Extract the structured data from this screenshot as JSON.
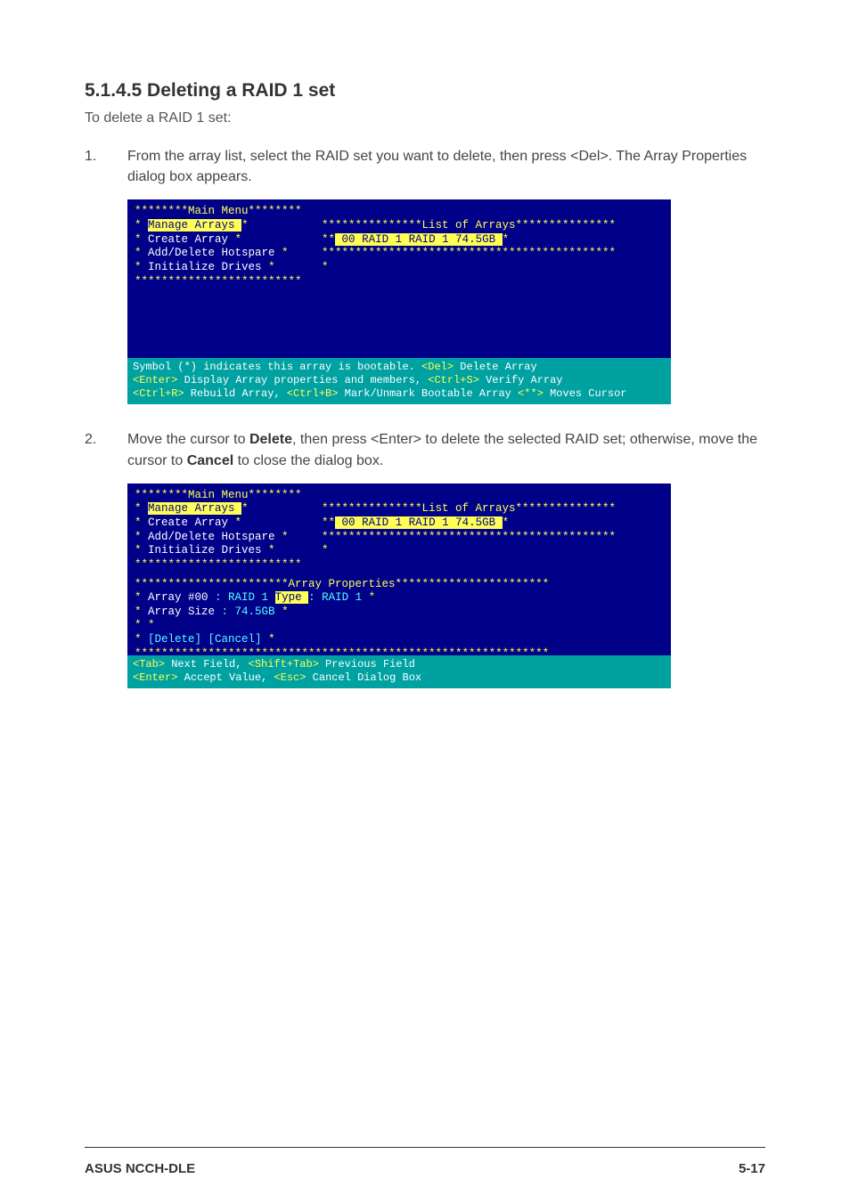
{
  "heading": "5.1.4.5 Deleting a RAID 1 set",
  "intro": "To delete a RAID 1 set:",
  "steps": {
    "s1": {
      "num": "1.",
      "text": "From the array list, select the RAID set you want to delete, then press <Del>. The Array Properties dialog box appears."
    },
    "s2": {
      "num": "2.",
      "prefix": "Move the cursor to ",
      "delete_label": "Delete",
      "mid": ", then press <Enter> to delete the selected RAID set; otherwise, move the cursor to ",
      "cancel_label": "Cancel",
      "suffix": " to close the dialog box."
    }
  },
  "terminal1": {
    "main_menu_title": "********Main Menu********",
    "menu_items": {
      "manage": "Manage Arrays",
      "create": "Create Array",
      "hotspare": "Add/Delete Hotspare",
      "init": "Initialize Drives"
    },
    "list_title": "***************List of Arrays***************",
    "array_row": {
      "id": "00",
      "name": "RAID 1",
      "type": "RAID 1",
      "size": "74.5GB"
    },
    "menu_border_bottom": "*************************",
    "list_border": "********************************************",
    "hints": {
      "l1a": " Symbol (*) indicates this array is bootable. ",
      "l1b": "<Del>",
      "l1c": " Delete Array",
      "l2a": "<Enter>",
      "l2b": " Display Array properties and members, ",
      "l2c": "<Ctrl+S>",
      "l2d": " Verify Array",
      "l3a": "<Ctrl+R>",
      "l3b": " Rebuild Array, ",
      "l3c": "<Ctrl+B>",
      "l3d": " Mark/Unmark Bootable Array ",
      "l3e": "<**>",
      "l3f": " Moves Cursor"
    }
  },
  "terminal2": {
    "main_menu_title": "********Main Menu********",
    "menu_items": {
      "manage": "Manage Arrays",
      "create": "Create Array",
      "hotspare": "Add/Delete Hotspare",
      "init": "Initialize Drives"
    },
    "list_title": "***************List of Arrays***************",
    "array_row": {
      "id": "00",
      "name": "RAID 1",
      "type": "RAID 1",
      "size": "74.5GB"
    },
    "menu_border_bottom": "*************************",
    "list_border": "********************************************",
    "props_title": "***********************Array Properties***********************",
    "props_border_bottom": "**************************************************************",
    "props": {
      "array_num_label": "Array #00",
      "array_num_val": ": RAID 1",
      "type_label": "Type",
      "type_val": ": RAID 1",
      "size_label": "Array Size",
      "size_val": ": 74.5GB"
    },
    "buttons": {
      "delete": "[Delete]",
      "cancel": "[Cancel]"
    },
    "hints": {
      "l1a": "<Tab>",
      "l1b": " Next Field, ",
      "l1c": "<Shift+Tab>",
      "l1d": " Previous Field",
      "l2a": "<Enter>",
      "l2b": " Accept Value, ",
      "l2c": "<Esc>",
      "l2d": " Cancel Dialog Box"
    }
  },
  "footer": {
    "left": "ASUS NCCH-DLE",
    "right": "5-17"
  }
}
